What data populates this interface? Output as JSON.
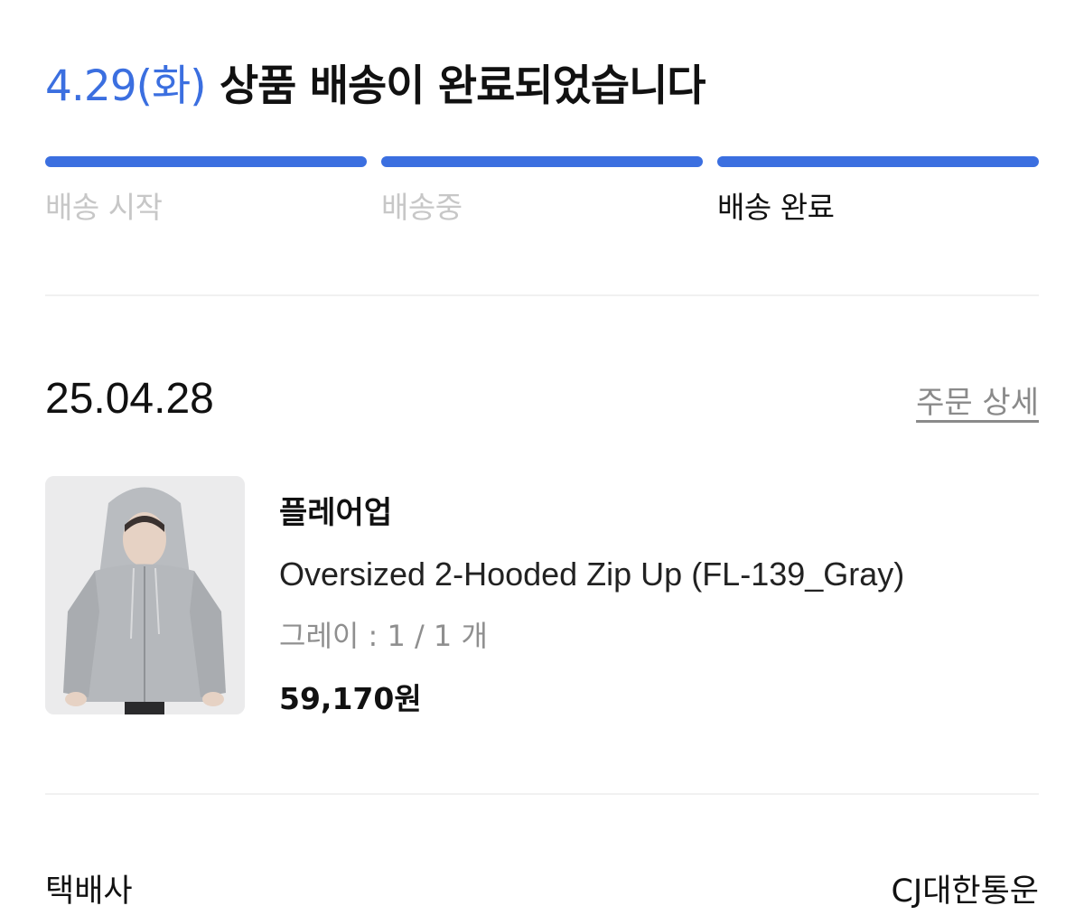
{
  "status": {
    "date": "4.29(화)",
    "message": "상품 배송이 완료되었습니다"
  },
  "progress": {
    "steps": [
      {
        "label": "배송 시작",
        "state": "done"
      },
      {
        "label": "배송중",
        "state": "done"
      },
      {
        "label": "배송 완료",
        "state": "current"
      }
    ],
    "active_color": "#3b6fe0",
    "inactive_text_color": "#c7c7c7"
  },
  "order": {
    "date": "25.04.28",
    "detail_link": "주문 상세"
  },
  "product": {
    "image_icon": "gray-hooded-zip-up-photo",
    "brand": "플레어업",
    "name": "Oversized 2-Hooded Zip Up (FL-139_Gray)",
    "option": "그레이 : 1 / 1 개",
    "price": "59,170원"
  },
  "shipping": {
    "courier_label": "택배사",
    "courier_value": "CJ대한통운"
  }
}
